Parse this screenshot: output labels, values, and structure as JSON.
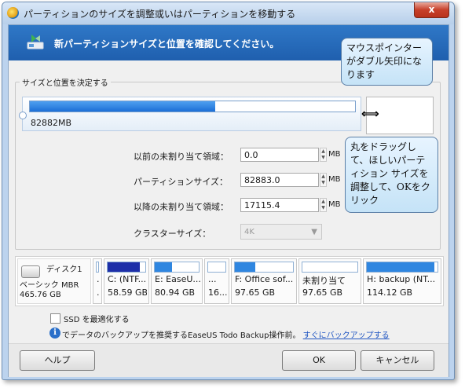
{
  "window": {
    "title": "パーティションのサイズを調整或いはパーティションを移動する",
    "close_label": "x"
  },
  "header": {
    "text": "新パーティションサイズと位置を確認してください。"
  },
  "group": {
    "legend": "サイズと位置を決定する"
  },
  "slider": {
    "size_label": "82882MB",
    "fill_fraction": 0.57
  },
  "fields": {
    "before_label": "以前の未割り当て領域：",
    "before_value": "0.0",
    "size_label": "パーティションサイズ：",
    "size_value": "82883.0",
    "after_label": "以降の未割り当て領域：",
    "after_value": "17115.4",
    "cluster_label": "クラスターサイズ：",
    "cluster_value": "4K",
    "unit": "MB"
  },
  "callouts": {
    "pointer": "マウスポインターがダブル矢印になります",
    "drag": "丸をドラッグして、ほしいパーティション サイズを調整して、OKをクリック"
  },
  "disk": {
    "name": "ディスク1",
    "type": "ベーシック MBR",
    "size": "465.76 GB",
    "partitions": [
      {
        "name": "...",
        "size": "...",
        "fill": 0.0,
        "color": "#2855c9"
      },
      {
        "name": "C: (NTF...",
        "size": "58.59 GB",
        "fill": 0.85,
        "color": "#1d2fa8"
      },
      {
        "name": "E: EaseU...",
        "size": "80.94 GB",
        "fill": 0.4,
        "color": "#2f86e0"
      },
      {
        "name": "...",
        "size": "16...",
        "fill": 0.0,
        "color": "#2f86e0"
      },
      {
        "name": "F: Office sof...",
        "size": "97.65 GB",
        "fill": 0.35,
        "color": "#2f86e0"
      },
      {
        "name": "未割り当て",
        "size": "97.65 GB",
        "fill": 0.0,
        "color": "#cfcfcf"
      },
      {
        "name": "H: backup (NT...",
        "size": "114.12 GB",
        "fill": 0.95,
        "color": "#2f86e0"
      }
    ]
  },
  "ssd": {
    "label": "SSD を最適化する"
  },
  "info": {
    "text": "でデータのバックアップを推奨するEaseUS Todo Backup操作前。",
    "link": "すぐにバックアップする"
  },
  "buttons": {
    "help": "ヘルプ",
    "ok": "OK",
    "cancel": "キャンセル"
  }
}
